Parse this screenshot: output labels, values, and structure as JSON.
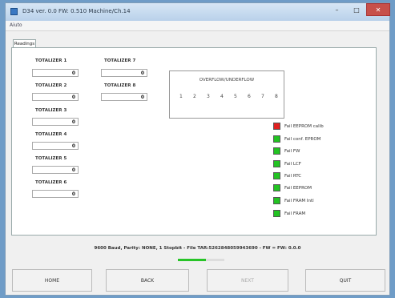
{
  "window": {
    "title": "D34 ver. 0.0 FW: 0.510 Machine/Ch.14"
  },
  "menu": {
    "item": "Aiuto"
  },
  "tab": {
    "label": "Readings"
  },
  "totalizers": [
    {
      "label": "TOTALIZER 1",
      "value": "0"
    },
    {
      "label": "TOTALIZER 2",
      "value": "0"
    },
    {
      "label": "TOTALIZER 3",
      "value": "0"
    },
    {
      "label": "TOTALIZER 4",
      "value": "0"
    },
    {
      "label": "TOTALIZER 5",
      "value": "0"
    },
    {
      "label": "TOTALIZER 6",
      "value": "0"
    },
    {
      "label": "TOTALIZER 7",
      "value": "0"
    },
    {
      "label": "TOTALIZER 8",
      "value": "0"
    }
  ],
  "overflow": {
    "title": "OVERFLOW/UNDERFLOW",
    "numbers": [
      "1",
      "2",
      "3",
      "4",
      "5",
      "6",
      "7",
      "8"
    ]
  },
  "indicators": [
    {
      "label": "Fail EEPROM calib",
      "color": "#e02020"
    },
    {
      "label": "Fail conf. EPROM",
      "color": "#22c322"
    },
    {
      "label": "Fail FW",
      "color": "#22c322"
    },
    {
      "label": "Fail LCF",
      "color": "#22c322"
    },
    {
      "label": "Fail RTC",
      "color": "#22c322"
    },
    {
      "label": "Fail EEPROM",
      "color": "#22c322"
    },
    {
      "label": "Fail FRAM Intl",
      "color": "#22c322"
    },
    {
      "label": "Fail FRAM",
      "color": "#22c322"
    }
  ],
  "status": {
    "text": "9600 Baud, Parity: NONE, 1 Stopbit - File TAR:5262848059943690 - FW = FW: 0.0.0",
    "progress": 0.6
  },
  "buttons": {
    "home": "HOME",
    "back": "BACK",
    "next": "NEXT",
    "quit": "QUIT"
  }
}
